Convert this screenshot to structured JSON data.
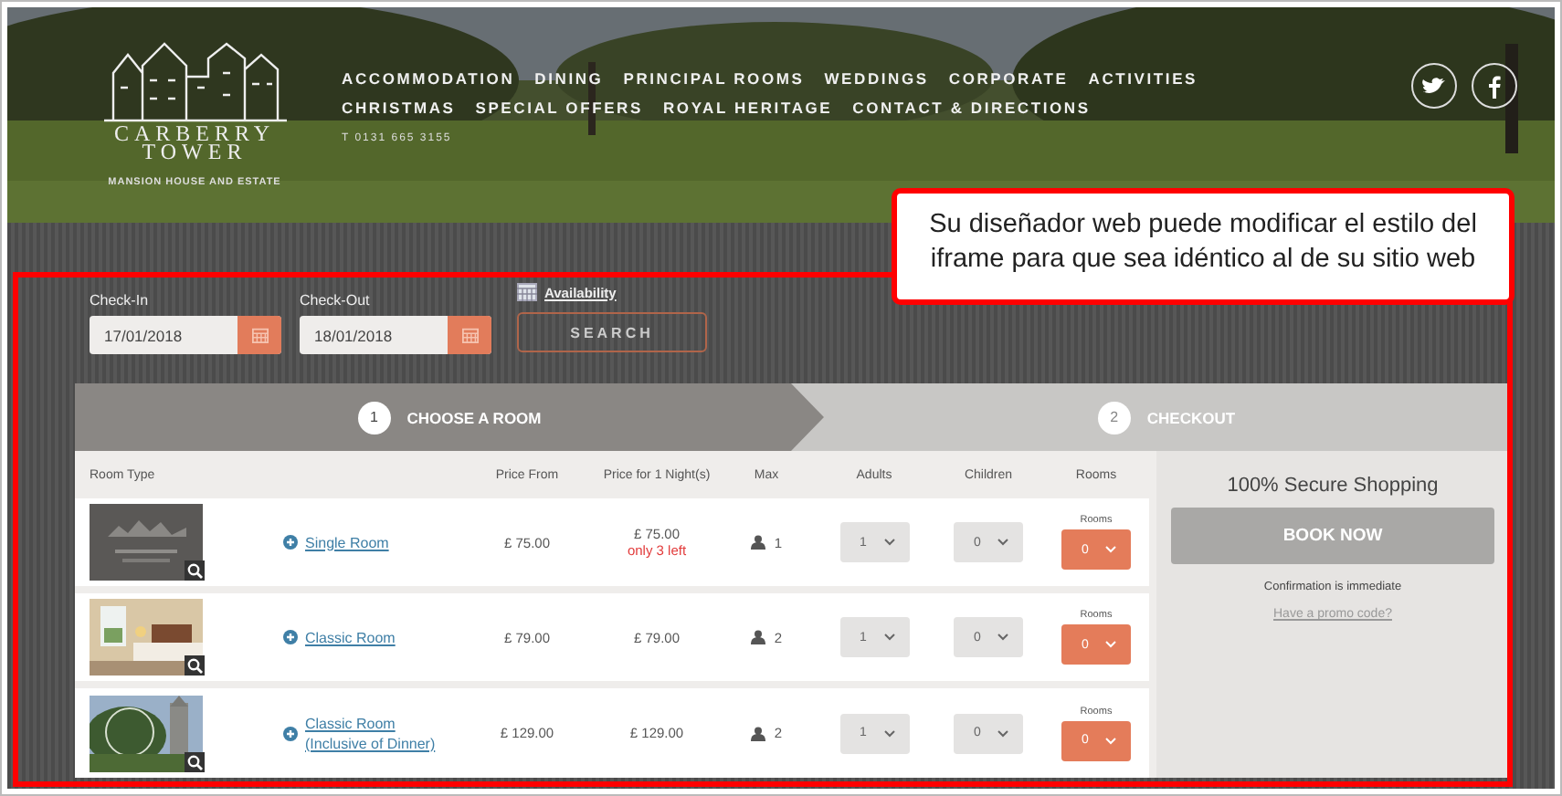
{
  "header": {
    "logo_lines": [
      "CARBERRY",
      "TOWER"
    ],
    "tagline": "MANSION HOUSE AND ESTATE",
    "nav": [
      [
        "ACCOMMODATION",
        "DINING",
        "PRINCIPAL ROOMS",
        "WEDDINGS",
        "CORPORATE",
        "ACTIVITIES"
      ],
      [
        "CHRISTMAS",
        "SPECIAL OFFERS",
        "ROYAL HERITAGE",
        "CONTACT & DIRECTIONS"
      ]
    ],
    "phone": "T 0131 665 3155"
  },
  "callout": "Su diseñador web puede modificar el estilo del iframe para que sea idéntico al de su sitio web",
  "search": {
    "checkin": {
      "label": "Check-In",
      "value": "17/01/2018"
    },
    "checkout": {
      "label": "Check-Out",
      "value": "18/01/2018"
    },
    "availability": "Availability",
    "button": "SEARCH"
  },
  "steps": [
    {
      "number": "1",
      "label": "CHOOSE A ROOM",
      "selected": true
    },
    {
      "number": "2",
      "label": "CHECKOUT",
      "selected": false
    }
  ],
  "columns": [
    "Room Type",
    "Price From",
    "Price for 1 Night(s)",
    "Max",
    "Adults",
    "Children",
    "Rooms"
  ],
  "rows": [
    {
      "name": "Single Room",
      "price_from": "£ 75.00",
      "price_night": "£ 75.00",
      "note": "only 3 left",
      "max": "1",
      "adults": "1",
      "children": "0",
      "rooms_label": "Rooms",
      "rooms": "0"
    },
    {
      "name": "Classic Room",
      "price_from": "£ 79.00",
      "price_night": "£ 79.00",
      "max": "2",
      "adults": "1",
      "children": "0",
      "rooms_label": "Rooms",
      "rooms": "0"
    },
    {
      "name": "Classic Room (Inclusive of Dinner)",
      "price_from": "£ 129.00",
      "price_night": "£ 129.00",
      "max": "2",
      "adults": "1",
      "children": "0",
      "rooms_label": "Rooms",
      "rooms": "0"
    }
  ],
  "sidebar": {
    "title": "100% Secure Shopping",
    "button": {
      "label": "BOOK NOW",
      "disabled": true
    },
    "confirmation": "Confirmation is immediate",
    "promo": "Have a promo code?"
  }
}
